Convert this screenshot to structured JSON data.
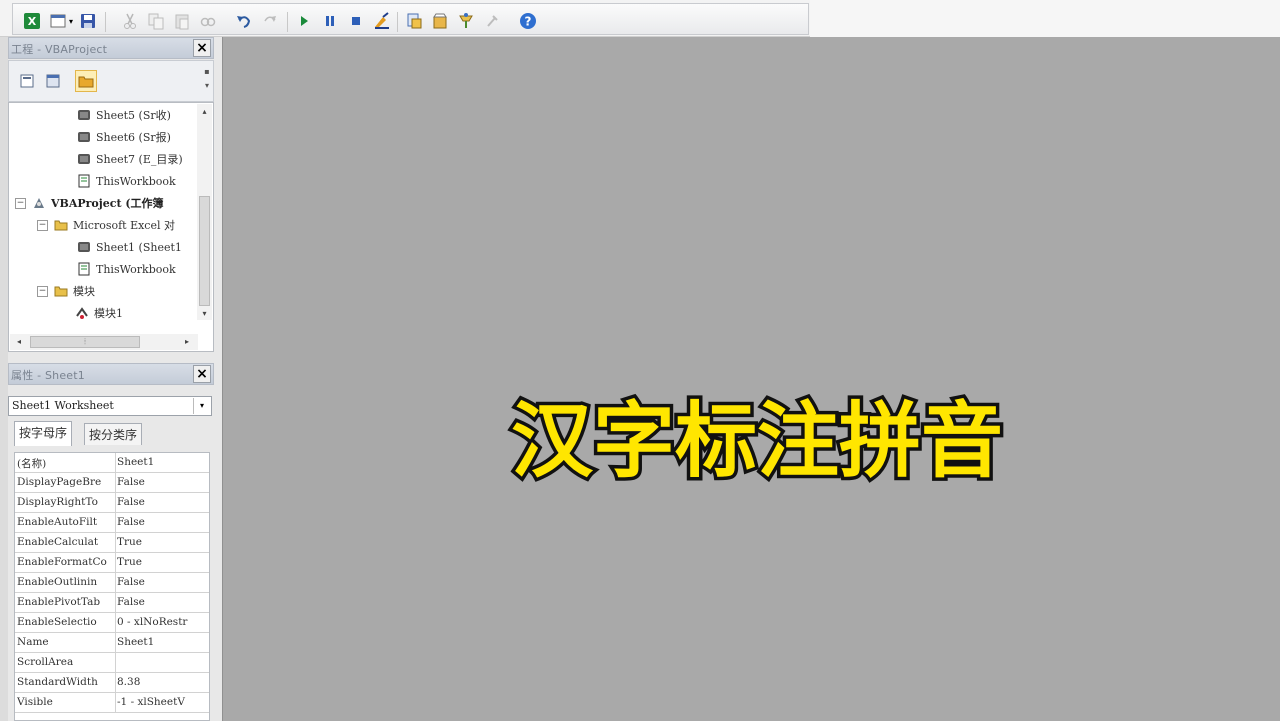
{
  "toolbar": {
    "icons": [
      "excel-view-icon",
      "insert-userform-icon",
      "save-icon",
      "cut-icon",
      "copy-icon",
      "paste-icon",
      "find-icon",
      "undo-icon",
      "redo-icon",
      "run-icon",
      "break-icon",
      "reset-icon",
      "design-mode-icon",
      "project-explorer-icon",
      "properties-icon",
      "object-browser-icon",
      "toolbox-icon",
      "help-icon"
    ]
  },
  "project_pane": {
    "title": "工程 - VBAProject",
    "close": "×",
    "tree": [
      {
        "label": "Sheet5 (Sr收)",
        "type": "sheet"
      },
      {
        "label": "Sheet6 (Sr报)",
        "type": "sheet"
      },
      {
        "label": "Sheet7 (E_目录)",
        "type": "sheet"
      },
      {
        "label": "ThisWorkbook",
        "type": "workbook"
      },
      {
        "label": "VBAProject (工作簿",
        "type": "project",
        "expander": "⊟"
      },
      {
        "label": "Microsoft Excel 对",
        "type": "folder",
        "expander": "⊟"
      },
      {
        "label": "Sheet1 (Sheet1",
        "type": "sheet"
      },
      {
        "label": "ThisWorkbook",
        "type": "workbook"
      },
      {
        "label": "模块",
        "type": "folder",
        "expander": "⊟"
      },
      {
        "label": "模块1",
        "type": "module"
      }
    ]
  },
  "properties_pane": {
    "title": "属性 - Sheet1",
    "close": "×",
    "object": "Sheet1 Worksheet",
    "tabs": [
      "按字母序",
      "按分类序"
    ],
    "rows": [
      {
        "k": "(名称)",
        "v": "Sheet1"
      },
      {
        "k": "DisplayPageBre",
        "v": "False"
      },
      {
        "k": "DisplayRightTo",
        "v": "False"
      },
      {
        "k": "EnableAutoFilt",
        "v": "False"
      },
      {
        "k": "EnableCalculat",
        "v": "True"
      },
      {
        "k": "EnableFormatCo",
        "v": "True"
      },
      {
        "k": "EnableOutlinin",
        "v": "False"
      },
      {
        "k": "EnablePivotTab",
        "v": "False"
      },
      {
        "k": "EnableSelectio",
        "v": "0 - xlNoRestr"
      },
      {
        "k": "Name",
        "v": "Sheet1"
      },
      {
        "k": "ScrollArea",
        "v": ""
      },
      {
        "k": "StandardWidth",
        "v": "8.38"
      },
      {
        "k": "Visible",
        "v": "-1 - xlSheetV"
      }
    ]
  },
  "overlay": {
    "title": "汉字标注拼音"
  },
  "colors": {
    "overlay_fill": "#ffe600",
    "overlay_stroke": "#111111",
    "workspace": "#a9a9a9"
  }
}
